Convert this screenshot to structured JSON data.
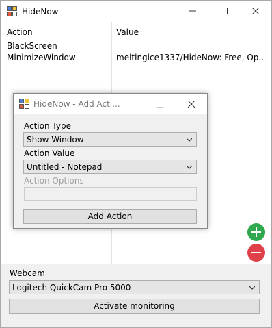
{
  "main_window": {
    "title": "HideNow",
    "list": {
      "columns": [
        "Action",
        "Value"
      ],
      "rows": [
        {
          "action": "BlackScreen",
          "value": ""
        },
        {
          "action": "MinimizeWindow",
          "value": "meltingice1337/HideNow: Free, Op..."
        }
      ]
    },
    "add_glyph": "+",
    "remove_glyph": "−",
    "webcam_label": "Webcam",
    "webcam_selected": "Logitech QuickCam Pro 5000",
    "activate_label": "Activate monitoring"
  },
  "dialog": {
    "title": "HideNow - Add Acti...",
    "action_type_label": "Action Type",
    "action_type_selected": "Show Window",
    "action_value_label": "Action Value",
    "action_value_selected": "Untitled - Notepad",
    "action_options_label": "Action Options",
    "action_options_value": "",
    "add_button_label": "Add Action"
  },
  "colors": {
    "add_green": "#2fa84f",
    "remove_red": "#e0404a",
    "disabled_text": "#a0a0a0"
  },
  "icons": [
    "app-icon",
    "minimize-icon",
    "maximize-icon",
    "close-icon",
    "chevron-down-icon",
    "plus-icon",
    "minus-icon"
  ]
}
